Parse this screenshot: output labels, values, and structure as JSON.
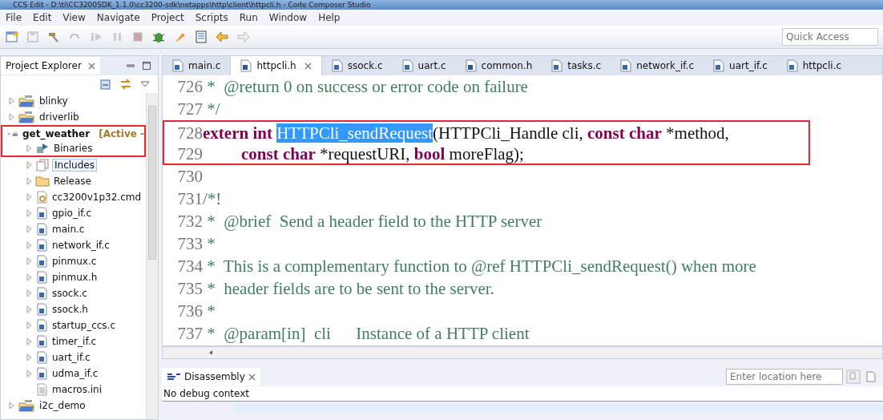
{
  "window": {
    "title": "CCS Edit - D:\\ti\\CC3200SDK_1.1.0\\cc3200-sdk\\netapps\\http\\client\\httpcli.h - Code Composer Studio"
  },
  "menu": [
    "File",
    "Edit",
    "View",
    "Navigate",
    "Project",
    "Scripts",
    "Run",
    "Window",
    "Help"
  ],
  "quick_access": {
    "placeholder": "Quick Access"
  },
  "project_explorer": {
    "title": "Project Explorer",
    "tree": [
      {
        "label": "blinky",
        "kind": "project",
        "expanded": false
      },
      {
        "label": "driverlib",
        "kind": "project",
        "expanded": false
      },
      {
        "label": "get_weather",
        "suffix": "[Active -",
        "kind": "project",
        "expanded": true,
        "boxed": true,
        "children": [
          {
            "label": "Binaries",
            "kind": "binaries",
            "expanded": false,
            "boxed": true
          },
          {
            "label": "Includes",
            "kind": "includes",
            "expanded": false,
            "selected": true
          },
          {
            "label": "Release",
            "kind": "folder",
            "expanded": false
          },
          {
            "label": "cc3200v1p32.cmd",
            "kind": "cmd",
            "expanded": false
          },
          {
            "label": "gpio_if.c",
            "kind": "c",
            "expanded": false
          },
          {
            "label": "main.c",
            "kind": "c",
            "expanded": false
          },
          {
            "label": "network_if.c",
            "kind": "c",
            "expanded": false
          },
          {
            "label": "pinmux.c",
            "kind": "c",
            "expanded": false
          },
          {
            "label": "pinmux.h",
            "kind": "h",
            "expanded": false
          },
          {
            "label": "ssock.c",
            "kind": "c",
            "expanded": false
          },
          {
            "label": "ssock.h",
            "kind": "h",
            "expanded": false
          },
          {
            "label": "startup_ccs.c",
            "kind": "c",
            "expanded": false
          },
          {
            "label": "timer_if.c",
            "kind": "c",
            "expanded": false
          },
          {
            "label": "uart_if.c",
            "kind": "c",
            "expanded": false
          },
          {
            "label": "udma_if.c",
            "kind": "c",
            "expanded": false
          },
          {
            "label": "macros.ini",
            "kind": "ini"
          }
        ]
      },
      {
        "label": "i2c_demo",
        "kind": "project",
        "expanded": false
      }
    ]
  },
  "editor": {
    "tabs": [
      {
        "label": "main.c",
        "kind": "c",
        "selected": false
      },
      {
        "label": "httpcli.h",
        "kind": "h",
        "selected": true
      },
      {
        "label": "ssock.c",
        "kind": "c",
        "selected": false
      },
      {
        "label": "uart.c",
        "kind": "c",
        "selected": false
      },
      {
        "label": "common.h",
        "kind": "h",
        "selected": false
      },
      {
        "label": "tasks.c",
        "kind": "c",
        "selected": false
      },
      {
        "label": "network_if.c",
        "kind": "c",
        "selected": false
      },
      {
        "label": "uart_if.c",
        "kind": "c",
        "selected": false
      },
      {
        "label": "httpcli.c",
        "kind": "c",
        "selected": false
      }
    ],
    "lines": [
      {
        "number": "726",
        "tokens": [
          {
            "kind": "comment",
            "text": " *  @return 0 on success or error code on failure"
          }
        ]
      },
      {
        "number": "727",
        "tokens": [
          {
            "kind": "comment",
            "text": " */"
          }
        ]
      },
      {
        "number": "728",
        "boxed": true,
        "tokens": [
          {
            "kind": "keyword",
            "text": "extern int "
          },
          {
            "kind": "selected",
            "text": "HTTPCli_sendRequest"
          },
          {
            "kind": "plain",
            "text": "(HTTPCli_Handle cli, "
          },
          {
            "kind": "keyword",
            "text": "const char"
          },
          {
            "kind": "plain",
            "text": " *method,"
          }
        ]
      },
      {
        "number": "729",
        "boxed": true,
        "indented": true,
        "tokens": [
          {
            "kind": "keyword",
            "text": "const char"
          },
          {
            "kind": "plain",
            "text": " *requestURI, "
          },
          {
            "kind": "keyword",
            "text": "bool"
          },
          {
            "kind": "plain",
            "text": " moreFlag);"
          }
        ]
      },
      {
        "number": "730"
      },
      {
        "number": "731",
        "tokens": [
          {
            "kind": "comment",
            "text": "/*!"
          }
        ]
      },
      {
        "number": "732",
        "tokens": [
          {
            "kind": "comment",
            "text": " *  @brief  Send a header field to the HTTP server"
          }
        ]
      },
      {
        "number": "733",
        "tokens": [
          {
            "kind": "comment",
            "text": " *"
          }
        ]
      },
      {
        "number": "734",
        "tokens": [
          {
            "kind": "comment",
            "text": " *  This is a complementary function to @ref HTTPCli_sendRequest() when more"
          }
        ]
      },
      {
        "number": "735",
        "tokens": [
          {
            "kind": "comment",
            "text": " *  header fields are to be sent to the server."
          }
        ]
      },
      {
        "number": "736",
        "tokens": [
          {
            "kind": "comment",
            "text": " *"
          }
        ]
      },
      {
        "number": "737",
        "tokens": [
          {
            "kind": "comment",
            "text": " *  @param[in]  cli      Instance of a HTTP client"
          }
        ]
      }
    ]
  },
  "disassembly": {
    "title": "Disassembly",
    "location": {
      "placeholder": "Enter location here"
    },
    "message": "No debug context"
  }
}
